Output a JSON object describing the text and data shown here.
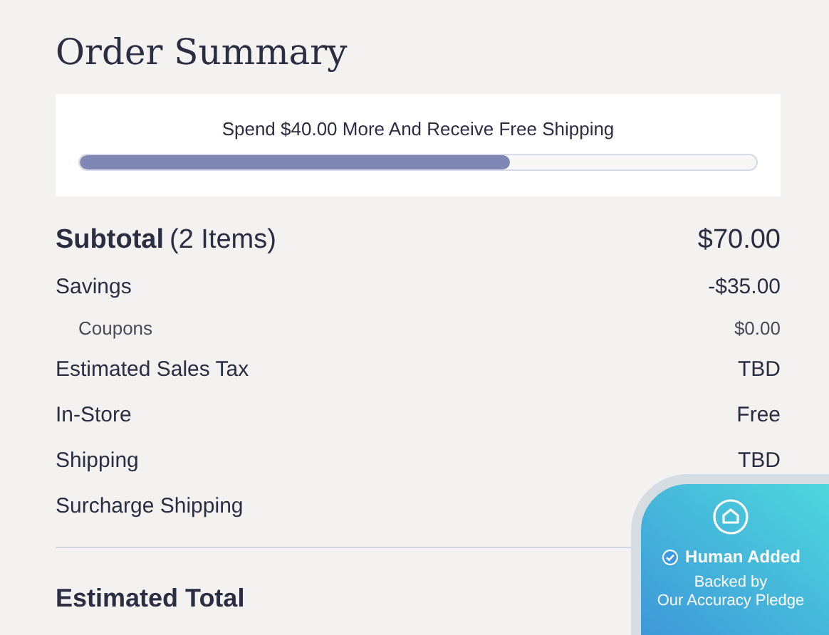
{
  "title": "Order Summary",
  "shipping_banner": {
    "message": "Spend $40.00 More And Receive Free Shipping",
    "level": 0.636
  },
  "subtotal": {
    "label": "Subtotal",
    "count": "(2 Items)",
    "value": "$70.00"
  },
  "lines": [
    {
      "label": "Savings",
      "value": "-$35.00",
      "kind": "main"
    },
    {
      "label": "Coupons",
      "value": "$0.00",
      "kind": "sub"
    },
    {
      "label": "Estimated Sales Tax",
      "value": "TBD",
      "kind": "main"
    },
    {
      "label": "In-Store",
      "value": "Free",
      "kind": "main"
    },
    {
      "label": "Shipping",
      "value": "TBD",
      "kind": "main"
    },
    {
      "label": "Surcharge Shipping",
      "kind": "main"
    }
  ],
  "total": {
    "label": "Estimated Total"
  },
  "badge": {
    "title": "Human Added",
    "subtitle_1": "Backed by",
    "subtitle_2": "Our Accuracy Pledge"
  }
}
